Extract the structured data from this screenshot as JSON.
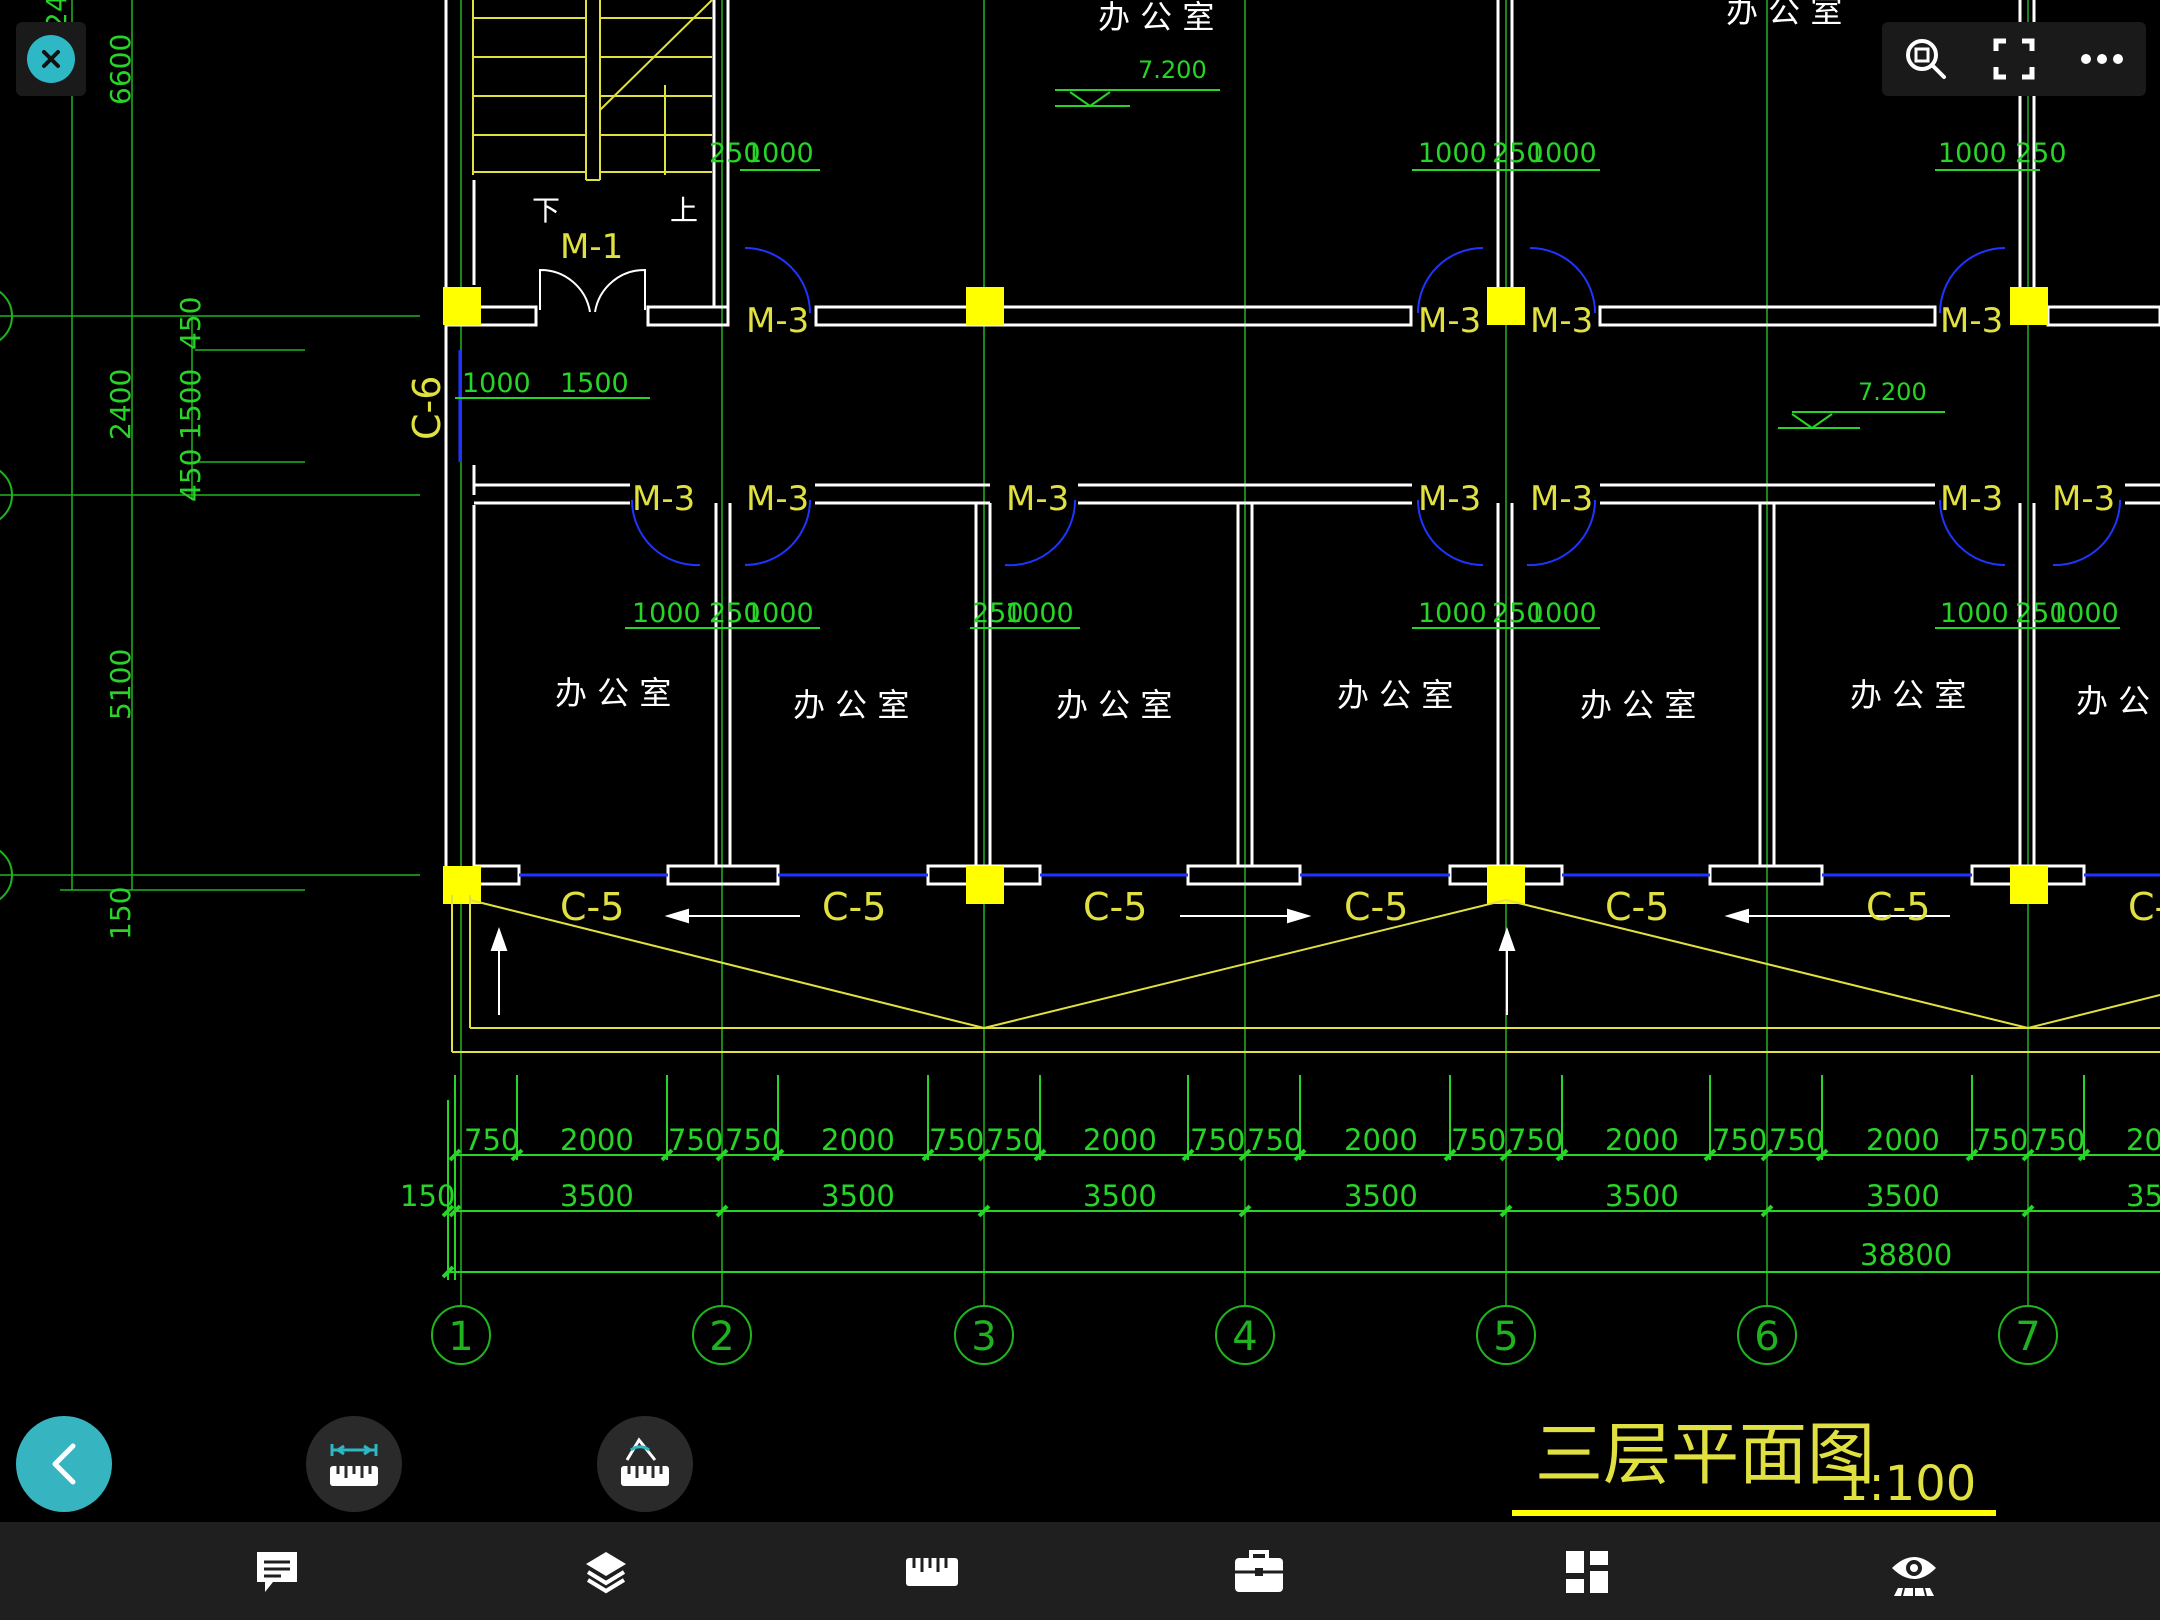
{
  "colors": {
    "background": "#000000",
    "grid": "#1fb41f",
    "dimension": "#27d427",
    "wall": "#ffffff",
    "column": "#ffff00",
    "annotation": "#e0e040",
    "door_swing": "#1f35ff",
    "accent": "#2eb7c4",
    "toolbar": "#1f1f1f"
  },
  "top_toolbar": {
    "icons": [
      "zoom-region-icon",
      "fullscreen-icon",
      "more-icon"
    ]
  },
  "bottom_tabs": [
    "comment-icon",
    "layers-icon",
    "ruler-icon",
    "toolbox-icon",
    "layout-icon",
    "view-icon"
  ],
  "fabs": [
    "back-icon",
    "linear-measure-icon",
    "angle-measure-icon"
  ],
  "drawing": {
    "title": "三层平面图",
    "scale": "1:100",
    "grid_axes": [
      "1",
      "2",
      "3",
      "4",
      "5",
      "6",
      "7"
    ],
    "room_label": "办 公 室",
    "room_label_partial": "办 公",
    "door_m1": "M-1",
    "door_m3": "M-3",
    "window_c5": "C-5",
    "window_c6": "C-6",
    "elevation": "7.200",
    "stair_down": "下",
    "stair_up": "上",
    "left_dims": [
      "6600",
      "2400",
      "5100",
      "150",
      "450",
      "1500",
      "450"
    ],
    "top_partial": "24",
    "dim_750": "750",
    "dim_2000": "2000",
    "dim_20_partial": "20",
    "dim_3500": "3500",
    "dim_35_partial": "35",
    "dim_150": "150",
    "dim_total": "38800",
    "dim_1000": "1000",
    "dim_250": "250",
    "dim_1500": "1500",
    "dim_c_partial": "C-"
  }
}
